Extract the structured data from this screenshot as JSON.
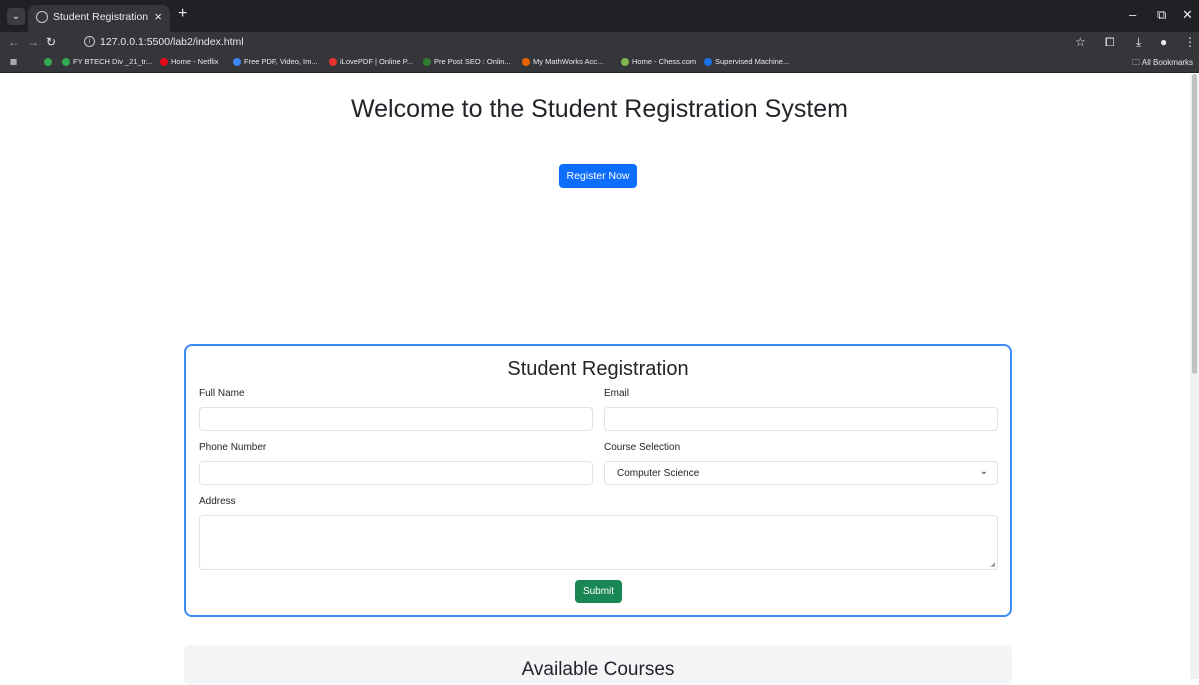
{
  "browser": {
    "tab_title": "Student Registration",
    "url": "127.0.0.1:5500/lab2/index.html",
    "bookmarks": [
      {
        "label": "FY BTECH Div _21_tr...",
        "color": "#34a853"
      },
      {
        "label": "Home - Netflix",
        "color": "#e50914"
      },
      {
        "label": "Free PDF, Video, Im...",
        "color": "#4285f4"
      },
      {
        "label": "iLovePDF | Online P...",
        "color": "#e5322d"
      },
      {
        "label": "Pre Post SEO : Onlin...",
        "color": "#2e7d32"
      },
      {
        "label": "My MathWorks Acc...",
        "color": "#e76500"
      },
      {
        "label": "Home - Chess.com",
        "color": "#81b64c"
      },
      {
        "label": "Supervised Machine...",
        "color": "#1a73e8"
      }
    ],
    "all_bookmarks": "All Bookmarks"
  },
  "page": {
    "welcome_title": "Welcome to the Student Registration System",
    "register_button": "Register Now",
    "form": {
      "title": "Student Registration",
      "full_name_label": "Full Name",
      "email_label": "Email",
      "phone_label": "Phone Number",
      "course_label": "Course Selection",
      "course_selected": "Computer Science",
      "address_label": "Address",
      "submit_button": "Submit"
    },
    "courses_title": "Available Courses"
  },
  "colors": {
    "primary": "#0d6efd",
    "success": "#198754",
    "card_border": "#3d8bfd"
  }
}
